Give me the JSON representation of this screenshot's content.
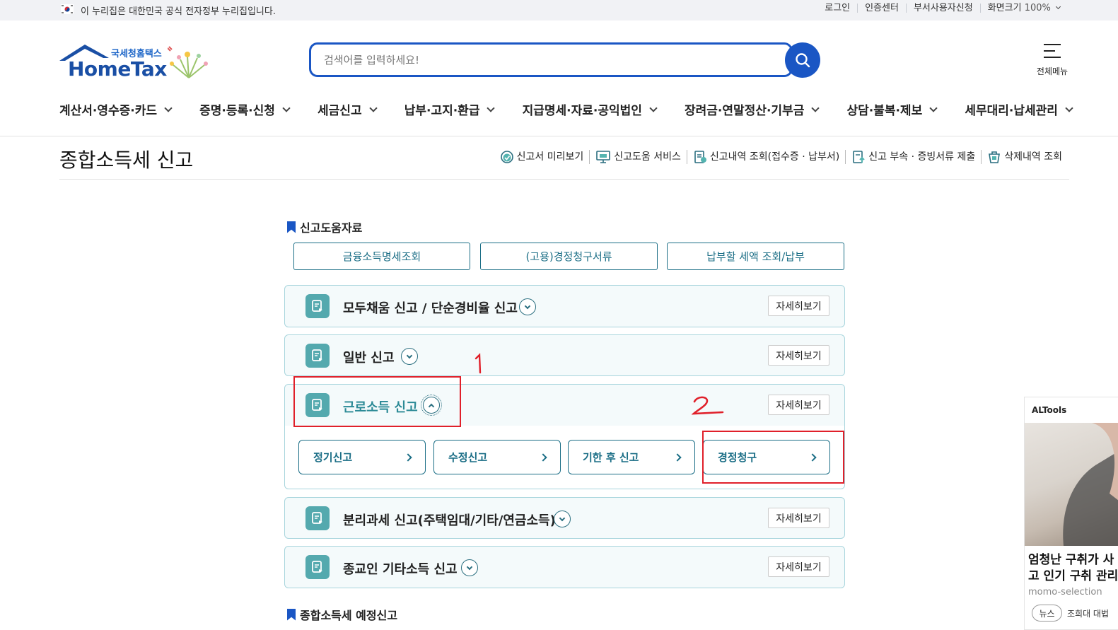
{
  "topbar": {
    "gov_notice": "이 누리집은 대한민국 공식 전자정부 누리집입니다.",
    "login": "로그인",
    "cert_center": "인증센터",
    "dept_user": "부서사용자신청",
    "screen_size": "화면크기",
    "zoom": "100%"
  },
  "logo": {
    "sub": "국세청홈택스",
    "main": "HomeTax"
  },
  "search": {
    "placeholder": "검색어를 입력하세요!"
  },
  "allmenu": {
    "label": "전체메뉴"
  },
  "gnb": [
    "계산서·영수증·카드",
    "증명·등록·신청",
    "세금신고",
    "납부·고지·환급",
    "지급명세·자료·공익법인",
    "장려금·연말정산·기부금",
    "상담·불복·제보",
    "세무대리·납세관리"
  ],
  "page": {
    "title": "종합소득세 신고",
    "quick": [
      "신고서 미리보기",
      "신고도움 서비스",
      "신고내역 조회(접수증 · 납부서)",
      "신고 부속 · 증빙서류 제출",
      "삭제내역 조회"
    ]
  },
  "help": {
    "label": "신고도움자료",
    "buttons": [
      "금융소득명세조회",
      "(고용)경정청구서류",
      "납부할 세액 조회/납부"
    ]
  },
  "accordions": [
    {
      "title": "모두채움 신고 / 단순경비율 신고",
      "more": "자세히보기"
    },
    {
      "title": "일반 신고",
      "more": "자세히보기"
    },
    {
      "title": "근로소득 신고",
      "more": "자세히보기"
    },
    {
      "title": "분리과세 신고(주택임대/기타/연금소득)",
      "more": "자세히보기"
    },
    {
      "title": "종교인 기타소득 신고",
      "more": "자세히보기"
    }
  ],
  "sub_buttons": [
    "정기신고",
    "수정신고",
    "기한 후 신고",
    "경정청구"
  ],
  "section2": {
    "label": "종합소득세 예정신고"
  },
  "ad": {
    "brand": "ALTools",
    "headline_1": "엄청난 구취가 사",
    "headline_2": "고 인기 구취 관리",
    "source": "momo-selection",
    "tag": "뉴스",
    "news_text": "조희대 대법"
  },
  "colors": {
    "accent": "#1a56c4",
    "teal": "#1b6e86",
    "annotation": "#e0202a"
  }
}
